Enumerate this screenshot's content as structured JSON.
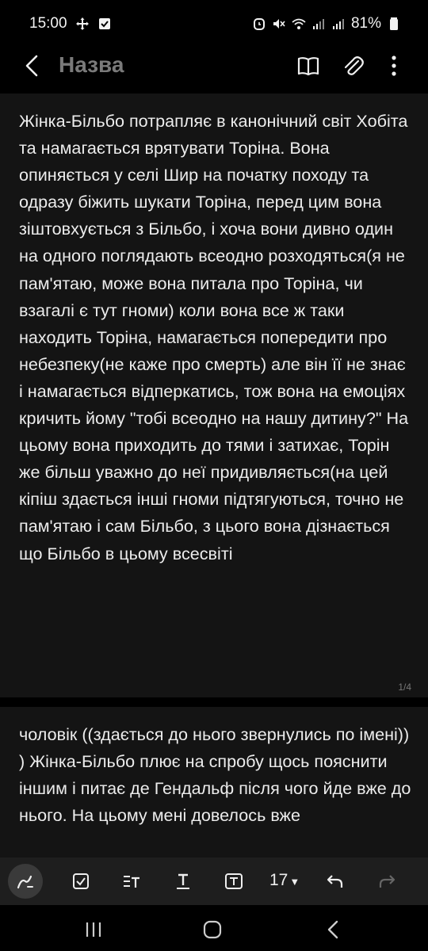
{
  "status_bar": {
    "time": "15:00",
    "battery": "81%",
    "icons_left": [
      "move-icon",
      "checkbox-icon"
    ],
    "icons_right": [
      "alarm-icon",
      "mute-icon",
      "wifi-icon",
      "signal-icon",
      "signal-icon",
      "battery-icon"
    ]
  },
  "header": {
    "title": "Назва",
    "actions": [
      "book-icon",
      "paperclip-icon",
      "more-icon"
    ]
  },
  "pages": [
    {
      "text": "Жінка-Більбо потрапляє в канонічний світ Хобіта та намагається врятувати Торіна. Вона опиняється у селі Шир на початку походу та одразу біжить шукати Торіна, перед цим вона зіштовхується з Більбо, і хоча вони дивно один на одного поглядають всеодно розходяться(я не пам'ятаю, може вона питала про Торіна, чи взагалі є тут гноми) коли вона все ж таки находить Торіна, намагається попередити про небезпеку(не каже про смерть) але він її не знає і намагається відперкатись, тож вона на емоціях кричить йому \"тобі всеодно на нашу дитину?\" На цьому вона приходить до тями і затихає, Торін же більш уважно до неї придивляється(на цей кіпіш здається інші гноми підтягуються, точно не пам'ятаю і сам Більбо, з цього вона дізнається що Більбо в цьому всесвіті",
      "counter": "1/4"
    },
    {
      "text": "чоловік ((здається до нього звернулись по імені)) ) Жінка-Більбо плює на спробу щось пояснити іншим і питає де Гендальф після чого йде вже до нього. На цьому мені довелось вже"
    }
  ],
  "toolbar": {
    "font_size": "17",
    "tools": [
      "pen-icon",
      "checkbox-icon",
      "text-style-icon",
      "text-underline-icon",
      "text-box-icon",
      "undo-icon",
      "redo-icon"
    ]
  },
  "nav": {
    "buttons": [
      "recents-icon",
      "home-icon",
      "back-icon"
    ]
  }
}
